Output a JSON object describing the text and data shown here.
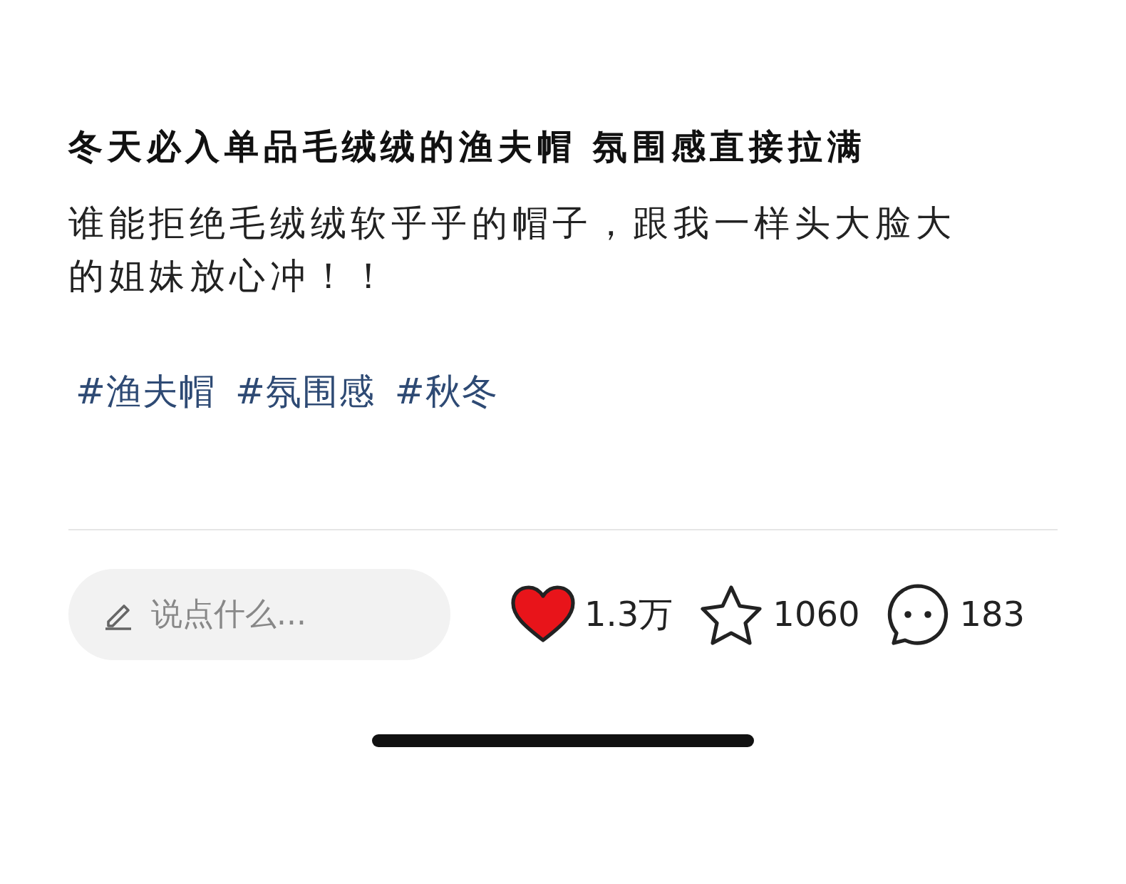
{
  "title": "冬天必入单品毛绒绒的渔夫帽 氛围感直接拉满",
  "body": "谁能拒绝毛绒绒软乎乎的帽子，跟我一样头大脸大的姐妹放心冲！！",
  "tags": [
    "#渔夫帽",
    "#氛围感",
    "#秋冬"
  ],
  "comment_field": {
    "placeholder": "说点什么..."
  },
  "actions": [
    {
      "kind": "like",
      "count": "1.3万",
      "selected": true
    },
    {
      "kind": "collect",
      "count": "1060",
      "selected": false
    },
    {
      "kind": "comment",
      "count": "183"
    }
  ]
}
